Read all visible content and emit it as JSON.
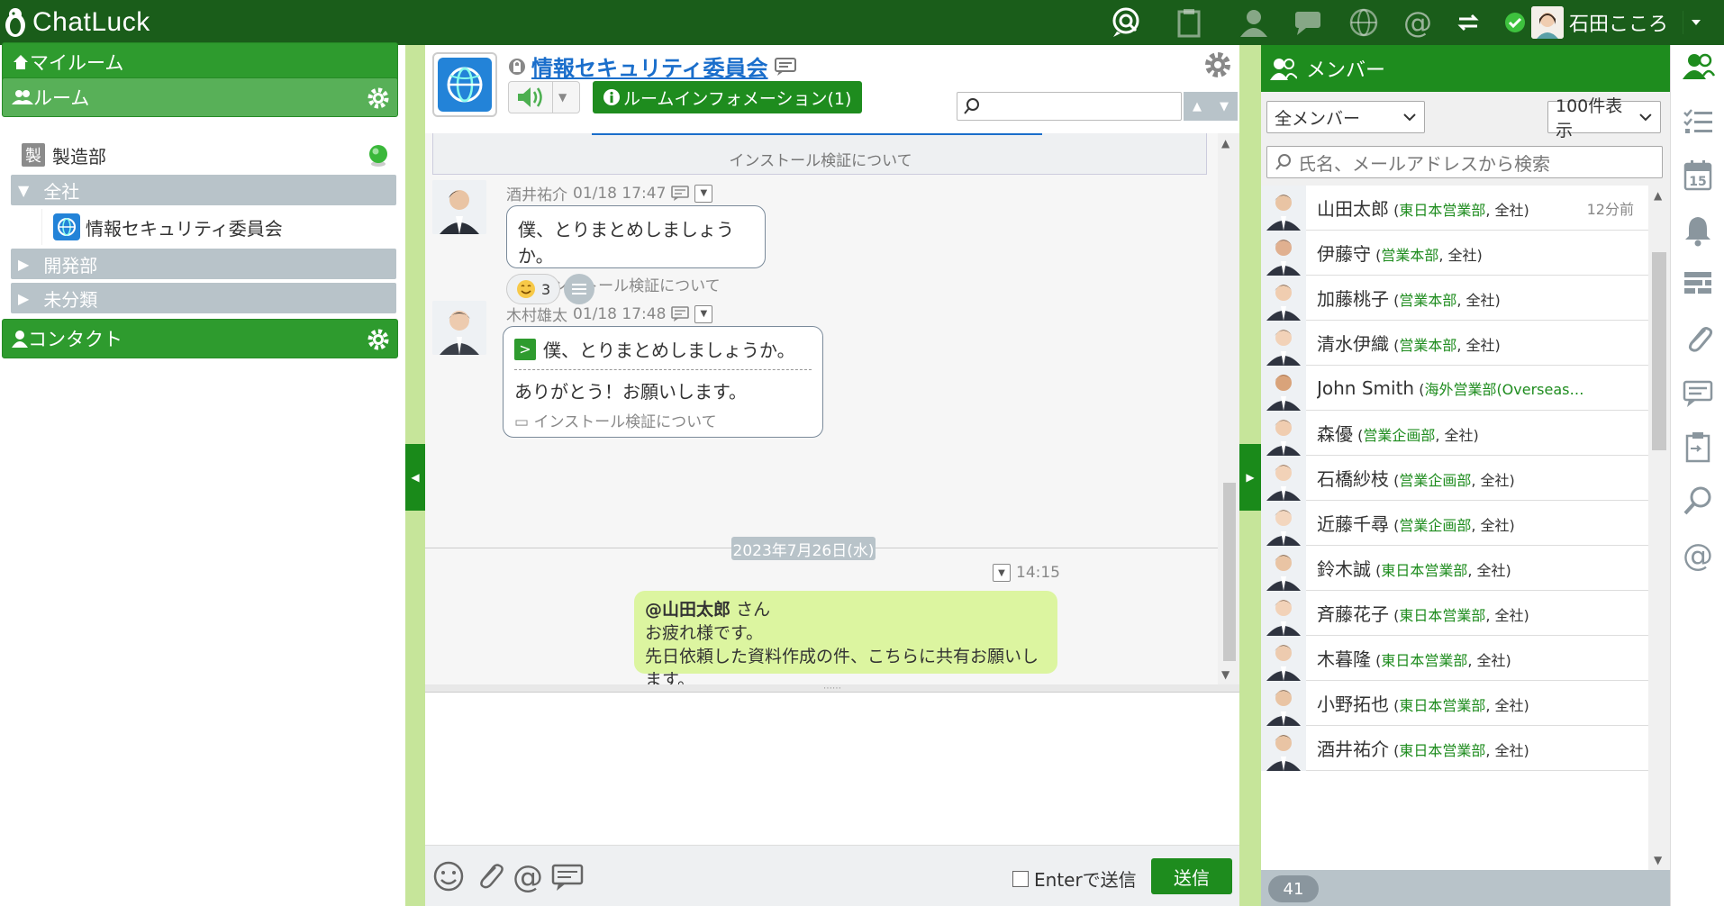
{
  "app": {
    "name": "ChatLuck"
  },
  "user": {
    "name": "石田こころ"
  },
  "sidebar": {
    "my_room": "マイルーム",
    "rooms": "ルーム",
    "room_manufacturing_badge": "製",
    "room_manufacturing": "製造部",
    "groups": [
      {
        "name": "全社",
        "expanded": true
      },
      {
        "name": "開発部",
        "expanded": false
      },
      {
        "name": "未分類",
        "expanded": false
      }
    ],
    "selected_room": "情報セキュリティ委員会",
    "contacts": "コンタクト"
  },
  "room": {
    "title": "情報セキュリティ委員会",
    "info_button": "ルームインフォメーション(1)"
  },
  "messages": {
    "prev_ref": "インストール検証について",
    "m1": {
      "author": "酒井祐介",
      "time": "01/18 17:47",
      "text": "僕、とりまとめしましょうか。",
      "ref": "インストール検証について",
      "reaction_count": "3"
    },
    "m2": {
      "author": "木村雄太",
      "time": "01/18 17:48",
      "quote_mark": ">",
      "quote": "僕、とりまとめしましょうか。",
      "text": "ありがとう！お願いします。",
      "ref": "インストール検証について"
    },
    "date_divider": "2023年7月26日(水)",
    "mine": {
      "time": "14:15",
      "mention": "@山田太郎",
      "honorific": "さん",
      "line1": "お疲れ様です。",
      "line2": "先日依頼した資料作成の件、こちらに共有お願いします。"
    }
  },
  "compose": {
    "enter_to_send": "Enterで送信",
    "send": "送信"
  },
  "members_panel": {
    "title": "メンバー",
    "filter": "全メンバー",
    "page_size": "100件表示",
    "search_placeholder": "氏名、メールアドレスから検索",
    "count": "41",
    "list": [
      {
        "name": "山田太郎",
        "dept": "東日本営業部",
        "org": "全社",
        "ago": "12分前"
      },
      {
        "name": "伊藤守",
        "dept": "営業本部",
        "org": "全社"
      },
      {
        "name": "加藤桃子",
        "dept": "営業本部",
        "org": "全社"
      },
      {
        "name": "清水伊織",
        "dept": "営業本部",
        "org": "全社"
      },
      {
        "name": "John Smith",
        "dept": "海外営業部(Overseas…",
        "org": ""
      },
      {
        "name": "森優",
        "dept": "営業企画部",
        "org": "全社"
      },
      {
        "name": "石橋紗枝",
        "dept": "営業企画部",
        "org": "全社"
      },
      {
        "name": "近藤千尋",
        "dept": "営業企画部",
        "org": "全社"
      },
      {
        "name": "鈴木誠",
        "dept": "東日本営業部",
        "org": "全社"
      },
      {
        "name": "斉藤花子",
        "dept": "東日本営業部",
        "org": "全社"
      },
      {
        "name": "木暮隆",
        "dept": "東日本営業部",
        "org": "全社"
      },
      {
        "name": "小野拓也",
        "dept": "東日本営業部",
        "org": "全社"
      },
      {
        "name": "酒井祐介",
        "dept": "東日本営業部",
        "org": "全社"
      }
    ]
  },
  "rail": {
    "calendar_day": "15"
  },
  "colors": {
    "topbar": "#1a5d1a",
    "green": "#1e8c1e",
    "my_bubble": "#dcf5a0",
    "link": "#1a6ecb"
  }
}
